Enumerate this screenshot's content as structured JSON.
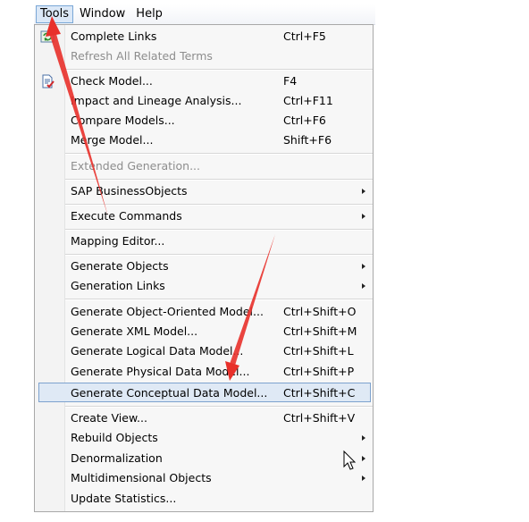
{
  "menubar": {
    "tools": "Tools",
    "window": "Window",
    "help": "Help"
  },
  "menu": {
    "complete_links": {
      "label": "Complete Links",
      "shortcut": "Ctrl+F5"
    },
    "refresh_terms": {
      "label": "Refresh All Related Terms"
    },
    "check_model": {
      "label": "Check Model...",
      "shortcut": "F4"
    },
    "impact_lineage": {
      "label": "Impact and Lineage Analysis...",
      "shortcut": "Ctrl+F11"
    },
    "compare_models": {
      "label": "Compare Models...",
      "shortcut": "Ctrl+F6"
    },
    "merge_model": {
      "label": "Merge Model...",
      "shortcut": "Shift+F6"
    },
    "extended_generation": {
      "label": "Extended Generation..."
    },
    "sap_businessobjects": {
      "label": "SAP BusinessObjects"
    },
    "execute_commands": {
      "label": "Execute Commands"
    },
    "mapping_editor": {
      "label": "Mapping Editor..."
    },
    "generate_objects": {
      "label": "Generate Objects"
    },
    "generation_links": {
      "label": "Generation Links"
    },
    "gen_oo_model": {
      "label": "Generate Object-Oriented Model...",
      "shortcut": "Ctrl+Shift+O"
    },
    "gen_xml_model": {
      "label": "Generate XML Model...",
      "shortcut": "Ctrl+Shift+M"
    },
    "gen_logical": {
      "label": "Generate Logical Data Model...",
      "shortcut": "Ctrl+Shift+L"
    },
    "gen_physical": {
      "label": "Generate Physical Data Model...",
      "shortcut": "Ctrl+Shift+P"
    },
    "gen_conceptual": {
      "label": "Generate Conceptual Data Model...",
      "shortcut": "Ctrl+Shift+C"
    },
    "create_view": {
      "label": "Create View...",
      "shortcut": "Ctrl+Shift+V"
    },
    "rebuild_objects": {
      "label": "Rebuild Objects"
    },
    "denormalization": {
      "label": "Denormalization"
    },
    "multidimensional": {
      "label": "Multidimensional Objects"
    },
    "update_statistics": {
      "label": "Update Statistics..."
    }
  },
  "colors": {
    "highlight_bg": "#dfe9f5",
    "highlight_border": "#7da2ce",
    "annotation_arrow": "#e8302a"
  },
  "icons": {
    "complete_links": "refresh-links-icon",
    "check_model": "check-model-icon",
    "pointer": "mouse-pointer-icon"
  }
}
